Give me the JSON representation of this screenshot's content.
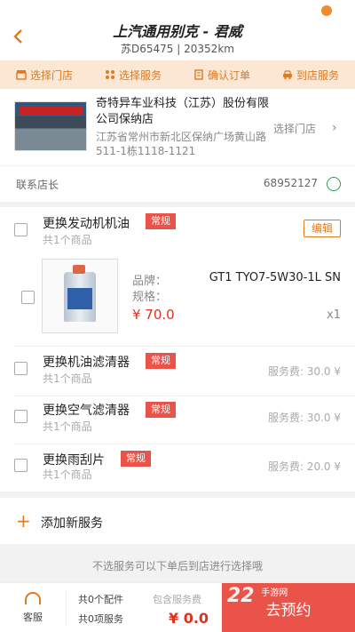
{
  "header": {
    "title": "上汽通用别克 - 君威",
    "plate": "苏D65475",
    "mileage": "20352km"
  },
  "steps": [
    {
      "label": "选择门店",
      "icon": "store-icon"
    },
    {
      "label": "选择服务",
      "icon": "service-icon"
    },
    {
      "label": "确认订单",
      "icon": "order-icon"
    },
    {
      "label": "到店服务",
      "icon": "car-icon"
    }
  ],
  "store": {
    "name": "奇特异车业科技（江苏）股份有限公司保纳店",
    "address": "江苏省常州市新北区保纳广场黄山路511-1栋1118-1121",
    "select_label": "选择门店"
  },
  "contact": {
    "label": "联系店长",
    "phone": "68952127"
  },
  "services": [
    {
      "name": "更换发动机机油",
      "tag": "常规",
      "sub": "共1个商品",
      "edit_label": "编辑",
      "product": {
        "brand_key": "品牌：",
        "spec_key": "规格：",
        "value": "GT1 TYO7-5W30-1L SN",
        "price": "¥ 70.0",
        "qty": "x1"
      }
    },
    {
      "name": "更换机油滤清器",
      "tag": "常规",
      "sub": "共1个商品",
      "fee": "服务费: 30.0 ¥"
    },
    {
      "name": "更换空气滤清器",
      "tag": "常规",
      "sub": "共1个商品",
      "fee": "服务费: 30.0 ¥"
    },
    {
      "name": "更换雨刮片",
      "tag": "常规",
      "sub": "共1个商品",
      "fee": "服务费: 20.0 ¥"
    }
  ],
  "add_service": {
    "label": "添加新服务"
  },
  "hint": "不选服务可以下单后到店进行选择哦",
  "footer": {
    "cs_label": "客服",
    "parts": "共0个配件",
    "services": "共0项服务",
    "included": "包含服务费",
    "total": "¥ 0.0",
    "book_label": "去预约",
    "watermark": "22",
    "watermark_small": "手游网"
  },
  "colors": {
    "accent": "#e07a1f",
    "tag": "#e9534a",
    "price": "#e0301e",
    "step_bg": "#fbe7d3"
  }
}
